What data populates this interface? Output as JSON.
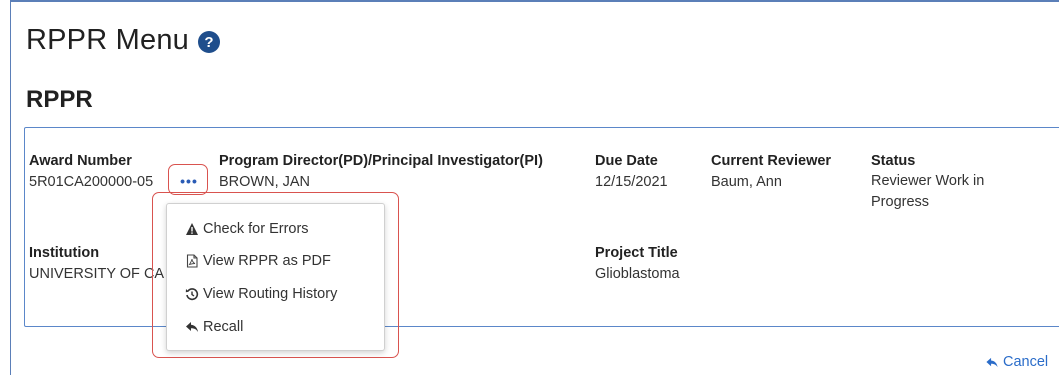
{
  "page": {
    "title": "RPPR Menu",
    "help_icon": "question-circle-icon"
  },
  "section": {
    "title": "RPPR"
  },
  "record": {
    "award_number": {
      "label": "Award Number",
      "value": "5R01CA200000-05"
    },
    "pd_pi": {
      "label": "Program Director(PD)/Principal Investigator(PI)",
      "value": "BROWN, JAN"
    },
    "due_date": {
      "label": "Due Date",
      "value": "12/15/2021"
    },
    "current_reviewer": {
      "label": "Current Reviewer",
      "value": "Baum, Ann"
    },
    "status": {
      "label": "Status",
      "value": "Reviewer Work in Progress"
    },
    "institution": {
      "label": "Institution",
      "value": "UNIVERSITY OF CA"
    },
    "project_title": {
      "label": "Project Title",
      "value": "Glioblastoma"
    }
  },
  "actions_button": {
    "label": "•••",
    "icon": "ellipsis-icon"
  },
  "actions_menu": {
    "items": [
      {
        "label": "Check for Errors",
        "icon": "warning-triangle-icon"
      },
      {
        "label": "View RPPR as PDF",
        "icon": "pdf-file-icon"
      },
      {
        "label": "View Routing History",
        "icon": "history-icon"
      },
      {
        "label": "Recall",
        "icon": "reply-icon"
      }
    ]
  },
  "footer": {
    "cancel_label": "Cancel",
    "cancel_icon": "reply-icon"
  },
  "colors": {
    "highlight": "#d9534f",
    "link": "#2a6cc9",
    "border": "#5b87c9",
    "help": "#1f4e8c"
  }
}
